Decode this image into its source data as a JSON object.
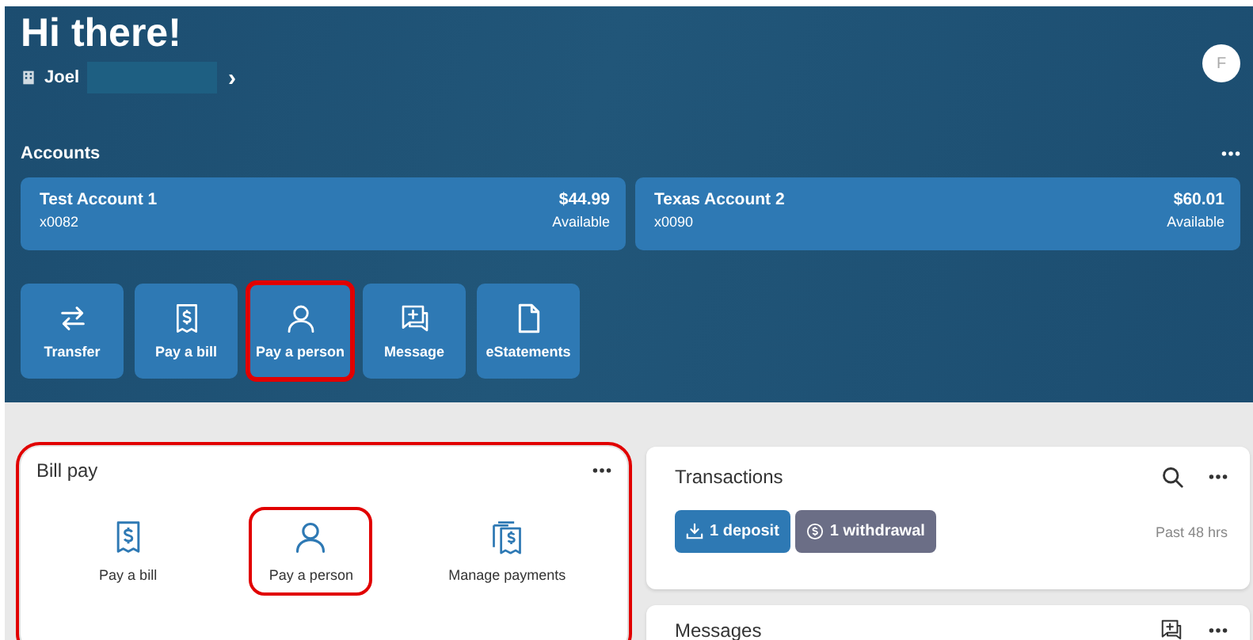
{
  "greeting": "Hi there!",
  "user": {
    "name": "Joel",
    "chevron": "›",
    "avatar": "F"
  },
  "accounts": {
    "title": "Accounts",
    "items": [
      {
        "name": "Test Account 1",
        "number": "x0082",
        "balance": "$44.99",
        "status": "Available"
      },
      {
        "name": "Texas Account 2",
        "number": "x0090",
        "balance": "$60.01",
        "status": "Available"
      }
    ]
  },
  "actions": [
    {
      "kind": "transfer",
      "label": "Transfer",
      "highlighted": false
    },
    {
      "kind": "bill",
      "label": "Pay a bill",
      "highlighted": false
    },
    {
      "kind": "person",
      "label": "Pay a person",
      "highlighted": true
    },
    {
      "kind": "message",
      "label": "Message",
      "highlighted": false
    },
    {
      "kind": "document",
      "label": "eStatements",
      "highlighted": false
    }
  ],
  "bill_pay": {
    "title": "Bill pay",
    "highlighted": true,
    "options": [
      {
        "kind": "bill",
        "label": "Pay a bill",
        "highlighted": false
      },
      {
        "kind": "person",
        "label": "Pay a person",
        "highlighted": true
      },
      {
        "kind": "bills",
        "label": "Manage payments",
        "highlighted": false
      }
    ]
  },
  "transactions": {
    "title": "Transactions",
    "chips": [
      {
        "kind": "deposit",
        "label": "1 deposit"
      },
      {
        "kind": "withdrawal",
        "label": "1 withdrawal"
      }
    ],
    "period": "Past 48 hrs"
  },
  "messages": {
    "title": "Messages"
  }
}
